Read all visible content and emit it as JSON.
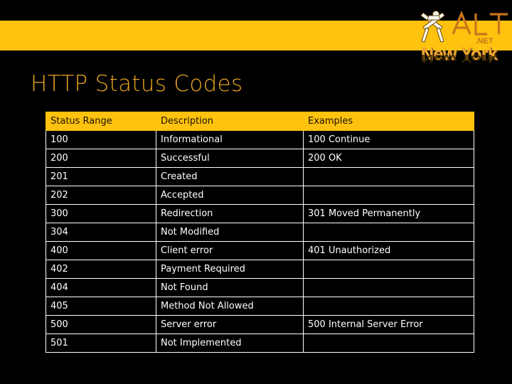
{
  "slide": {
    "title": "HTTP Status Codes",
    "background_color": "#000000",
    "banner_color": "#FFC20E",
    "title_color": "#E8A526"
  },
  "logo": {
    "brand": "ALT",
    "suffix": ".NET",
    "city": "New York",
    "accent_color": "#F0A830"
  },
  "table": {
    "headers": [
      "Status Range",
      "Description",
      "Examples"
    ],
    "rows": [
      {
        "range": "100",
        "description": "Informational",
        "example": "100 Continue"
      },
      {
        "range": "200",
        "description": "Successful",
        "example": "200 OK"
      },
      {
        "range": "201",
        "description": "Created",
        "example": ""
      },
      {
        "range": "202",
        "description": "Accepted",
        "example": ""
      },
      {
        "range": "300",
        "description": "Redirection",
        "example": "301 Moved Permanently"
      },
      {
        "range": "304",
        "description": "Not Modified",
        "example": ""
      },
      {
        "range": "400",
        "description": "Client error",
        "example": "401 Unauthorized"
      },
      {
        "range": "402",
        "description": "Payment Required",
        "example": ""
      },
      {
        "range": "404",
        "description": "Not Found",
        "example": ""
      },
      {
        "range": "405",
        "description": "Method Not Allowed",
        "example": ""
      },
      {
        "range": "500",
        "description": "Server error",
        "example": "500 Internal Server Error"
      },
      {
        "range": "501",
        "description": "Not Implemented",
        "example": ""
      }
    ]
  }
}
